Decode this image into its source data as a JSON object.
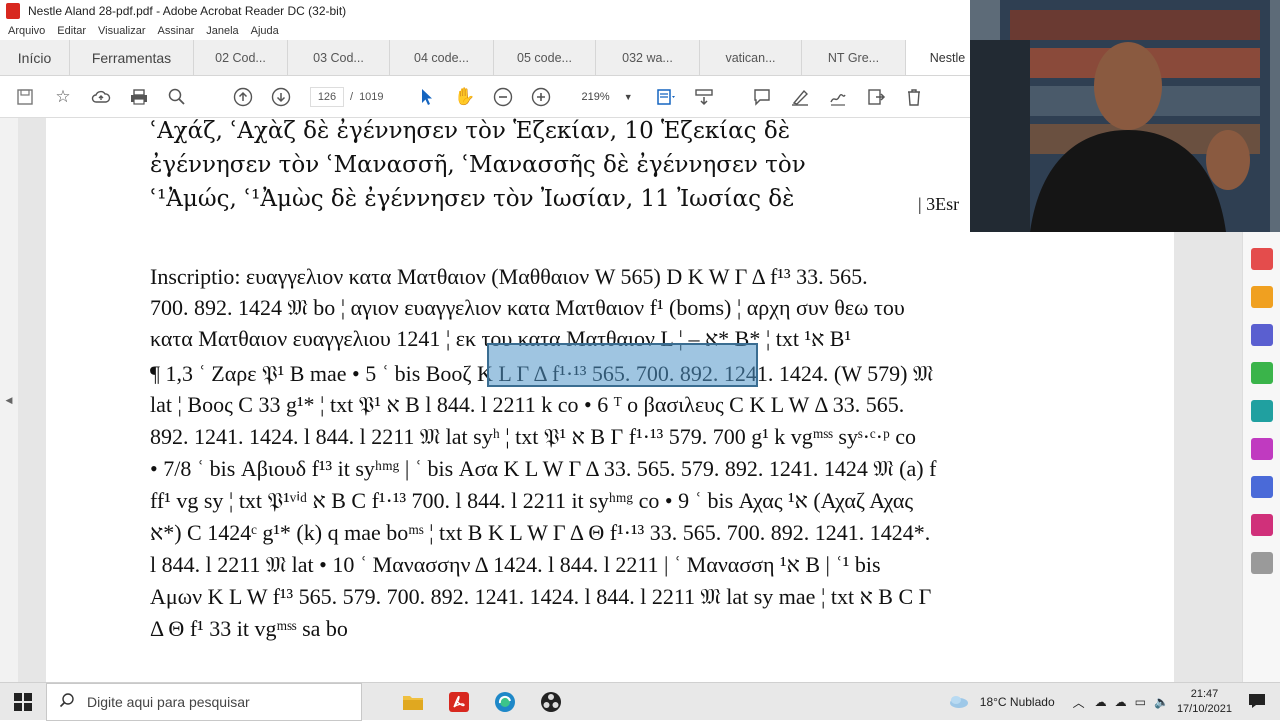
{
  "window": {
    "title": "Nestle Aland 28-pdf.pdf - Adobe Acrobat Reader DC (32-bit)"
  },
  "menu": [
    "Arquivo",
    "Editar",
    "Visualizar",
    "Assinar",
    "Janela",
    "Ajuda"
  ],
  "tabs": [
    {
      "label": "Início"
    },
    {
      "label": "Ferramentas"
    },
    {
      "label": "02 Cod..."
    },
    {
      "label": "03 Cod..."
    },
    {
      "label": "04 code..."
    },
    {
      "label": "05 code..."
    },
    {
      "label": "032 wa..."
    },
    {
      "label": "vatican..."
    },
    {
      "label": "NT Gre..."
    },
    {
      "label": "Nestle"
    }
  ],
  "toolbar": {
    "page_current": "126",
    "page_sep": "/",
    "page_total": "1019",
    "zoom": "219%"
  },
  "document": {
    "text_lines": [
      "ʿΑχάζ, ʿΑχὰζ δὲ ἐγέννησεν τὸν Ἑζεκίαν, 10 Ἑζεκίας δὲ",
      "ἐγέννησεν τὸν ʿΜανασσῆ, ʿΜανασσῆς δὲ ἐγέννησεν τὸν",
      "ʿ¹Ἀμώς, ʿ¹Ἀμὼς δὲ ἐγέννησεν τὸν Ἰωσίαν, 11 Ἰωσίας δὲ"
    ],
    "side_ref": "| 3Esr",
    "apparatus_lines": [
      "Inscriptio: ευαγγελιον κατα Ματθαιον (Μαθθαιον W 565) D K W Γ Δ f¹³ 33. 565.",
      "700. 892. 1424 𝔐 bo ¦ αγιον ευαγγελιον κατα Ματθαιον f¹ (boms) ¦ αρχη συν θεω του",
      "κατα Ματθαιον ευαγγελιου 1241 ¦ εκ του κατα Ματθαιον L ¦ – א* B* ¦ txt א¹ B¹",
      "¶ 1,3 ʿ Ζαρε 𝔓¹ B mae   • 5 ʿ bis Βοοζ K L Γ Δ f¹·¹³ 565. 700. 892. 1241. 1424. (W 579) 𝔐",
      "lat ¦ Βοος C 33 g¹* ¦ txt 𝔓¹ א B l 844. l 2211 k co   • 6 ᵀ ο βασιλευς C K L W Δ 33. 565.",
      "892. 1241. 1424. l 844. l 2211 𝔐 lat syʰ ¦ txt 𝔓¹ א B Γ f¹·¹³ 579. 700 g¹ k vgᵐˢˢ syˢ·ᶜ·ᵖ co",
      "• 7/8 ʿ bis Αβιουδ f¹³ it syʰᵐᵍ | ʿ bis Ασα K L W Γ Δ 33. 565. 579. 892. 1241. 1424 𝔐 (a) f",
      "ff¹ vg sy ¦ txt 𝔓¹ᵛⁱᵈ א B C f¹·¹³ 700. l 844. l 2211 it syʰᵐᵍ co   • 9 ʿ bis Αχας א¹ (Αχαζ Αχας",
      "א*) C 1424ᶜ g¹* (k) q mae boᵐˢ ¦ txt B K L W Γ Δ Θ f¹·¹³ 33. 565. 700. 892. 1241. 1424*.",
      "l 844. l 2211 𝔐 lat   • 10 ʿ Μανασσην Δ 1424. l 844. l 2211 | ʿ Μανασση א¹ B | ʿ¹ bis",
      "Αμων K L W f¹³ 565. 579. 700. 892. 1241. 1424. l 844. l 2211 𝔐 lat sy mae ¦ txt א B C Γ",
      "Δ Θ f¹ 33 it vgᵐˢˢ sa bo"
    ]
  },
  "taskbar": {
    "search_placeholder": "Digite aqui para pesquisar",
    "weather": "18°C  Nublado",
    "time": "21:47",
    "date": "17/10/2021"
  },
  "colors": {
    "pdf_red": "#d8281f",
    "highlight": "#5096c8",
    "taskbar": "#e8e8e8"
  },
  "icons": [
    "save-icon",
    "star-icon",
    "upload-icon",
    "print-icon",
    "search-zoom-icon",
    "page-up-icon",
    "page-down-icon",
    "cursor-icon",
    "hand-icon",
    "zoom-out-icon",
    "zoom-in-icon",
    "fit-icon",
    "scroll-icon",
    "comment-icon",
    "highlight-icon",
    "sign-icon",
    "export-icon",
    "delete-icon"
  ]
}
